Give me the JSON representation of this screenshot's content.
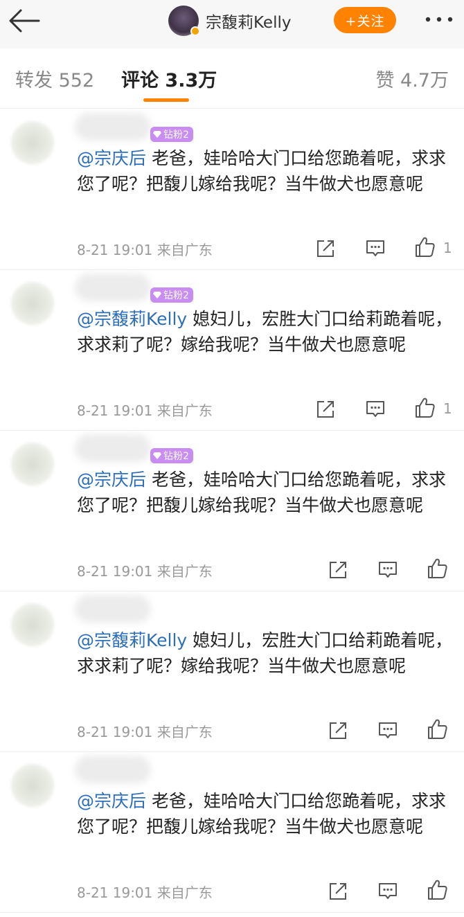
{
  "header": {
    "author_name": "宗馥莉Kelly",
    "follow_label": "+关注",
    "accent_color": "#ff8200"
  },
  "tabs": {
    "repost_label": "转发",
    "repost_count": "552",
    "comment_label": "评论",
    "comment_count": "3.3万",
    "like_label": "赞",
    "like_count": "4.7万"
  },
  "comments": [
    {
      "fan_badge": "钻粉2",
      "mention": "@宗庆后",
      "text": " 老爸，娃哈哈大门口给您跪着呢，求求您了呢？把馥儿嫁给我呢？当牛做犬也愿意呢",
      "time": "8-21 19:01",
      "location": "来自广东",
      "likes": "1"
    },
    {
      "fan_badge": "钻粉2",
      "mention": "@宗馥莉Kelly",
      "text": " 媳妇儿，宏胜大门口给莉跪着呢，求求莉了呢？嫁给我呢？当牛做犬也愿意呢",
      "time": "8-21 19:01",
      "location": "来自广东",
      "likes": "1"
    },
    {
      "fan_badge": "钻粉2",
      "mention": "@宗庆后",
      "text": " 老爸，娃哈哈大门口给您跪着呢，求求您了呢？把馥儿嫁给我呢？当牛做犬也愿意呢",
      "time": "8-21 19:01",
      "location": "来自广东",
      "likes": ""
    },
    {
      "fan_badge": "",
      "mention": "@宗馥莉Kelly",
      "text": " 媳妇儿，宏胜大门口给莉跪着呢，求求莉了呢？嫁给我呢？当牛做犬也愿意呢",
      "time": "8-21 19:01",
      "location": "来自广东",
      "likes": ""
    },
    {
      "fan_badge": "",
      "mention": "@宗庆后",
      "text": " 老爸，娃哈哈大门口给您跪着呢，求求您了呢？把馥儿嫁给我呢？当牛做犬也愿意呢",
      "time": "8-21 19:01",
      "location": "来自广东",
      "likes": ""
    }
  ],
  "icons": {
    "back": "back-arrow-icon",
    "more": "more-dots-icon",
    "share": "share-icon",
    "reply": "reply-icon",
    "like": "thumbs-up-icon",
    "badge": "diamond-icon"
  }
}
